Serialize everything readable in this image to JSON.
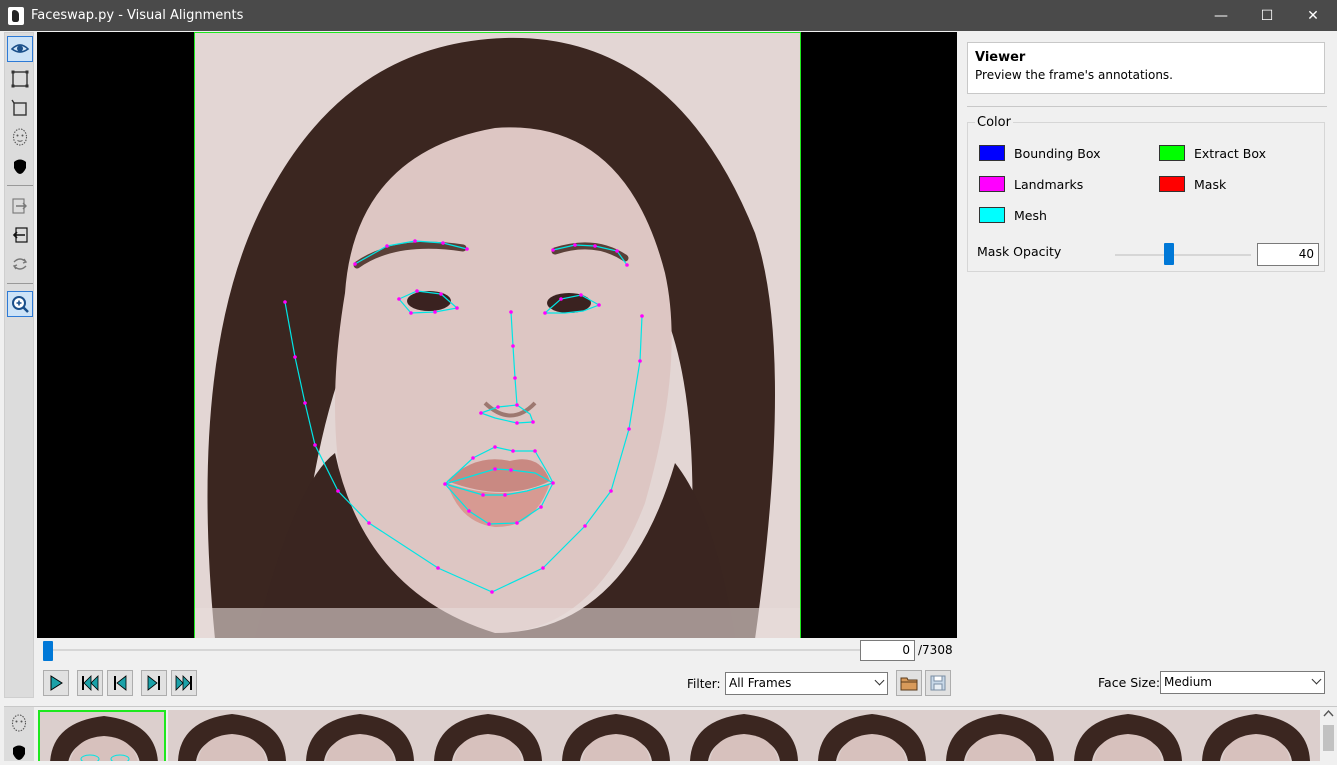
{
  "window": {
    "title": "Faceswap.py - Visual Alignments",
    "min": "—",
    "max": "☐",
    "close": "✕"
  },
  "toolbar": {
    "tools": [
      "view-icon",
      "bounding-box-icon",
      "extract-box-icon",
      "landmarks-icon",
      "mask-icon",
      "copy-next-icon",
      "copy-prev-icon",
      "revert-icon",
      "zoom-icon"
    ]
  },
  "navigation": {
    "frame_value": "0",
    "frame_total": "/7308",
    "frame_progress": 0.0
  },
  "filter": {
    "label": "Filter:",
    "selected": "All Frames"
  },
  "viewer": {
    "title": "Viewer",
    "description": "Preview the frame's annotations."
  },
  "color": {
    "group_label": "Color",
    "items": [
      {
        "label": "Bounding Box",
        "color": "#0000ff"
      },
      {
        "label": "Extract Box",
        "color": "#00ff00"
      },
      {
        "label": "Landmarks",
        "color": "#ff00ff"
      },
      {
        "label": "Mask",
        "color": "#ff0000"
      },
      {
        "label": "Mesh",
        "color": "#00ffff"
      }
    ],
    "opacity_label": "Mask Opacity",
    "opacity_value": "40",
    "opacity_fraction": 0.4
  },
  "face_size": {
    "label": "Face Size:",
    "selected": "Medium"
  },
  "accent_colors": {
    "extract_box": "#1ee81e",
    "mesh": "#00e5e5",
    "landmark_point": "#ff00ff",
    "slider": "#0078d7"
  }
}
